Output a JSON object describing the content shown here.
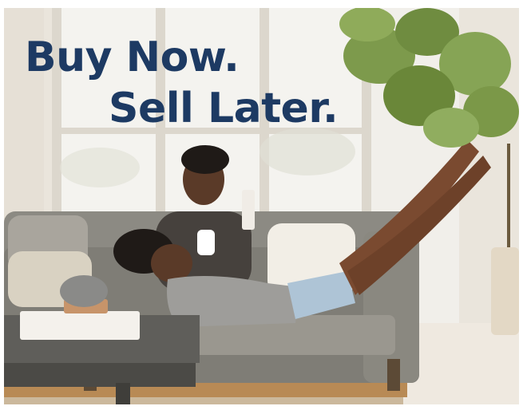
{
  "ad": {
    "headline_line1": "Buy Now.",
    "headline_line2": "Sell Later.",
    "headline_color": "#1d3a63"
  },
  "scene": {
    "description_icons": [
      "window",
      "sofa",
      "person-sitting",
      "person-lying",
      "coffee-table",
      "books",
      "vase",
      "fiddle-leaf-plant",
      "basket"
    ]
  }
}
